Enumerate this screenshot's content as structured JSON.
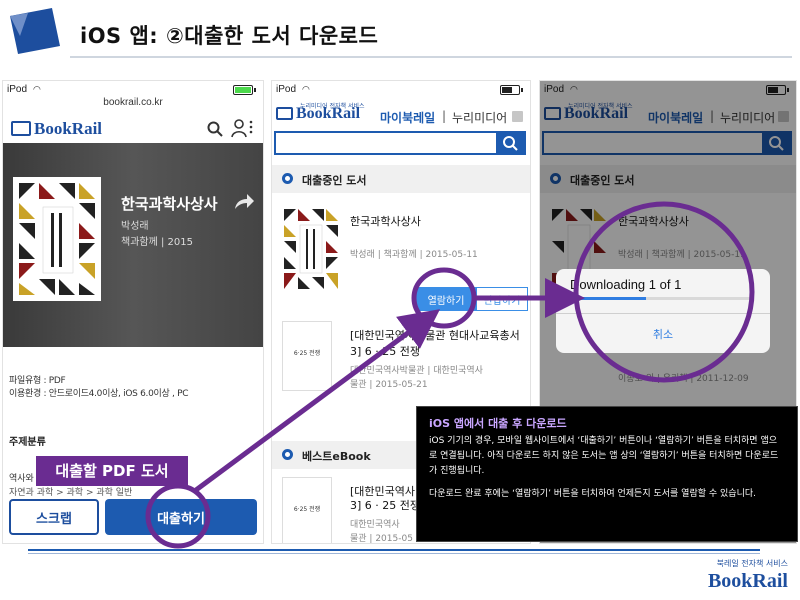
{
  "slide": {
    "title": "iOS 앱: ②대출한 도서 다운로드"
  },
  "status": {
    "carrier": "iPod",
    "wifi_icon": "wifi-icon",
    "battery_icon": "battery-icon"
  },
  "phone1": {
    "url": "bookrail.co.kr",
    "brand_book": "Book",
    "brand_rail": "Rail",
    "book_title": "한국과학사상사",
    "author": "박성래",
    "publisher_year": "책과함께 | 2015",
    "file_type": "파일유형 : PDF",
    "environment": "이용환경 : 안드로이드4.0이상, iOS 6.0이상 , PC",
    "section_head": "주제분류",
    "category_label": "역사와",
    "category_path": "자연과 과학 > 과학 > 과학 일반",
    "scrap_label": "스크랩",
    "borrow_label": "대출하기"
  },
  "phone2": {
    "brand_sub": "누리미디어 전자책 서비스",
    "brand_book": "Book",
    "brand_rail": "Rail",
    "nav_active": "마이북레일",
    "nav_sep": "|",
    "nav_item": "누리미디어",
    "section_borrowed": "대출중인 도서",
    "section_best": "베스트eBook",
    "book1_title": "한국과학사상사",
    "book1_meta": "박성래 | 책과함께 | 2015-05-11",
    "open_label": "열람하기",
    "return_label": "반납하기",
    "book2_title_1": "[대한민국역사박물관 현대사교육총서",
    "book2_title_2": "3] 6 · 25 전쟁",
    "book2_meta_1": "대한민국역사박물관 | 대한민국역사",
    "book2_meta_2": "물관 | 2015-05-21",
    "book3_title_1": "[대한민국역사",
    "book3_title_2": "3] 6 · 25 전쟁",
    "book3_meta_1": "대한민국역사",
    "book3_meta_2": "물관 | 2015-05",
    "thumb_label": "6·25 전쟁"
  },
  "phone3": {
    "brand_sub": "누리미디어 전자책 서비스",
    "brand_book": "Book",
    "brand_rail": "Rail",
    "nav_active": "마이북레일",
    "nav_sep": "|",
    "nav_item": "누리미디어",
    "section_borrowed": "대출중인 도서",
    "book1_title": "한국과학사상사",
    "book1_meta": "박성래 | 책과함께 | 2015-05-11",
    "book2_meta": "이종호 외 | 우리책 | 2011-12-09",
    "dialog_text": "Downloading 1 of 1",
    "progress": 0.42,
    "cancel_label": "취소"
  },
  "annotation": {
    "pdf_tag": "대출할 PDF 도서"
  },
  "callout": {
    "title": "iOS 앱에서 대출 후 다운로드",
    "body_1": "iOS 기기의 경우, 모바일 웹사이트에서 ‘대출하기’ 버튼이나 ‘열람하기’ 버튼을 터치하면 앱으로 연결됩니다. 아직 다운로드 하지 않은 도서는 앱 상의 ‘열람하기’ 버튼을 터치하면 다운로드가 진행됩니다.",
    "body_2": "다운로드 완료 후에는 ‘열람하기’ 버튼을 터치하여 언제든지 도서를 열람할 수 있습니다."
  },
  "footer": {
    "sub": "북레일 전자책 서비스",
    "name": "BookRail"
  },
  "colors": {
    "brand_blue": "#1d5bb0",
    "accent_purple": "#6a2c91",
    "open_button": "#3a8ee6"
  }
}
